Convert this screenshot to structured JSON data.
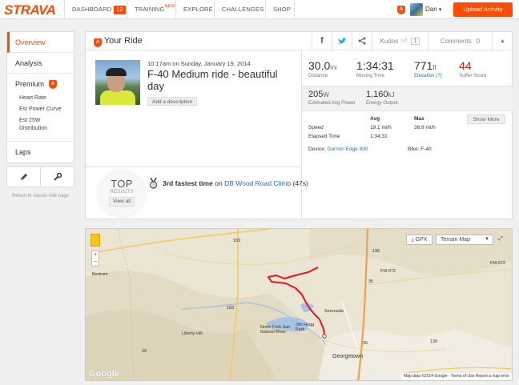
{
  "brand": {
    "logo": "STRAVA",
    "accent": "#fc4c02"
  },
  "nav": {
    "dashboard": "DASHBOARD",
    "dashboard_badge": "12",
    "training": "TRAINING",
    "training_new": "NEW",
    "explore": "EXPLORE",
    "challenges": "CHALLENGES",
    "shop": "SHOP",
    "premium_badge": "A",
    "user_name": "Dan",
    "user_caret": "▾",
    "upload": "Upload Activity"
  },
  "sidebar": {
    "overview": "Overview",
    "analysis": "Analysis",
    "premium": "Premium",
    "premium_badge": "A",
    "sub_items": [
      "Heart Rate",
      "Est Power Curve",
      "Est 25W Distribution"
    ],
    "laps": "Laps",
    "return_link": "Return to classic ride page"
  },
  "panel": {
    "badge": "A",
    "title": "Your Ride",
    "kudos_label": "Kudos",
    "kudos_count": "1",
    "comments_label": "Comments",
    "comments_count": "0"
  },
  "ride": {
    "date": "10:17am on Sunday, January 19, 2014",
    "title": "F-40 Medium ride - beautiful day",
    "description_button": "Add a description"
  },
  "stats": {
    "distance": {
      "value": "30.0",
      "unit": "mi",
      "label": "Distance"
    },
    "moving_time": {
      "value": "1:34:31",
      "label": "Moving Time"
    },
    "elevation": {
      "value": "771",
      "unit": "ft",
      "label": "Elevation (?)"
    },
    "suffer": {
      "value": "44",
      "label": "Suffer Score"
    },
    "power": {
      "value": "205",
      "unit": "W",
      "label": "Estimated Avg Power"
    },
    "energy": {
      "value": "1,160",
      "unit": "kJ",
      "label": "Energy Output"
    }
  },
  "table": {
    "col_avg": "Avg",
    "col_max": "Max",
    "speed_label": "Speed",
    "speed_avg": "19.1 mi/h",
    "speed_max": "36.9 mi/h",
    "elapsed_label": "Elapsed Time",
    "elapsed_value": "1:34:31",
    "show_more": "Show More",
    "device_label": "Device:",
    "device_value": "Garmin Edge 800",
    "bike_label": "Bike:",
    "bike_value": "F-40"
  },
  "results": {
    "top": "TOP",
    "results": "RESULTS",
    "view_all": "View all",
    "fastest_prefix": "3rd fastest time",
    "fastest_on": "on",
    "segment": "DB Wood Road Climb",
    "segment_time": "(47s)"
  },
  "map": {
    "gpx": "GPX",
    "map_type": "Terrain Map",
    "zoom_in": "+",
    "zoom_out": "−",
    "google": "Google",
    "footer": "Map data ©2014 Google - Terms of Use  Report a map error",
    "labels": {
      "bertram": "Bertram",
      "liberty_hill": "Liberty Hill",
      "serenada": "Serenada",
      "jim_hogg": "Jim Hogg Park",
      "north_fork": "North Fork San Gabriel River",
      "georgetown": "Georgetown",
      "fm972": "FM-972",
      "fm972b": "FM-972",
      "r183": "183",
      "r183b": "183",
      "r29": "29",
      "r35": "35",
      "r35b": "35",
      "r195": "195",
      "r130": "130"
    },
    "route_color": "#e8141c"
  }
}
